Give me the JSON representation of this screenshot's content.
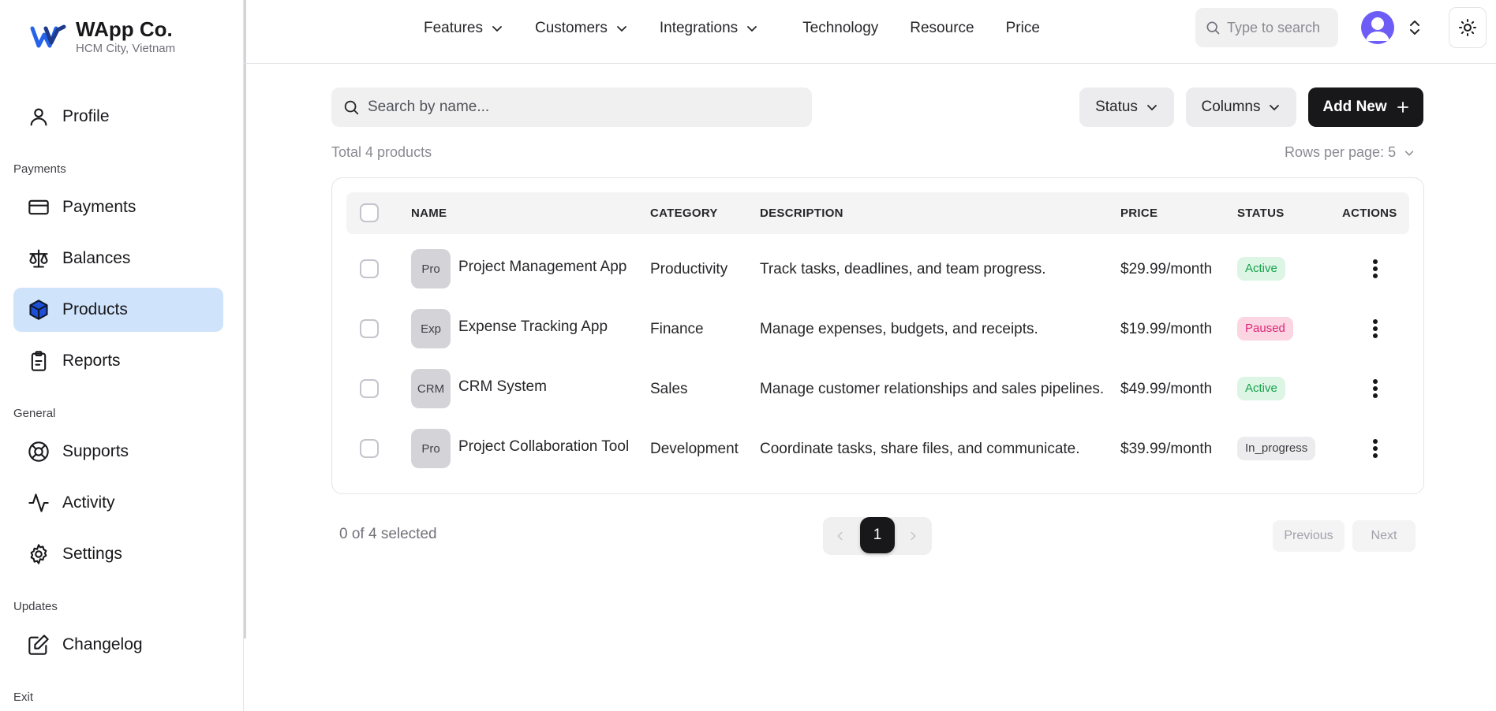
{
  "brand": {
    "name": "WApp Co.",
    "location": "HCM City, Vietnam"
  },
  "sidebar": {
    "profile": "Profile",
    "sections": {
      "payments": "Payments",
      "general": "General",
      "updates": "Updates",
      "exit": "Exit"
    },
    "items": {
      "payments": "Payments",
      "balances": "Balances",
      "products": "Products",
      "reports": "Reports",
      "supports": "Supports",
      "activity": "Activity",
      "settings": "Settings",
      "changelog": "Changelog"
    },
    "active": "products"
  },
  "topnav": {
    "links": [
      "Features",
      "Customers",
      "Integrations",
      "Technology",
      "Resource",
      "Price"
    ],
    "search_placeholder": "Type to search"
  },
  "toolbar": {
    "search_placeholder": "Search by name...",
    "status_label": "Status",
    "columns_label": "Columns",
    "add_label": "Add New"
  },
  "summary": {
    "total": "Total 4 products",
    "rows_per_page": "Rows per page: 5"
  },
  "table": {
    "headers": {
      "name": "NAME",
      "category": "CATEGORY",
      "description": "DESCRIPTION",
      "price": "PRICE",
      "status": "STATUS",
      "actions": "ACTIONS"
    },
    "rows": [
      {
        "thumb": "Pro",
        "name": "Project Management App",
        "category": "Productivity",
        "description": "Track tasks, deadlines, and team progress.",
        "price": "$29.99/month",
        "status": "Active",
        "status_type": "active"
      },
      {
        "thumb": "Exp",
        "name": "Expense Tracking App",
        "category": "Finance",
        "description": "Manage expenses, budgets, and receipts.",
        "price": "$19.99/month",
        "status": "Paused",
        "status_type": "paused"
      },
      {
        "thumb": "CRM",
        "name": "CRM System",
        "category": "Sales",
        "description": "Manage customer relationships and sales pipelines.",
        "price": "$49.99/month",
        "status": "Active",
        "status_type": "active"
      },
      {
        "thumb": "Pro",
        "name": "Project Collaboration Tool",
        "category": "Development",
        "description": "Coordinate tasks, share files, and communicate.",
        "price": "$39.99/month",
        "status": "In_progress",
        "status_type": "progress"
      }
    ]
  },
  "footer": {
    "selected": "0 of 4 selected",
    "current_page": "1",
    "previous": "Previous",
    "next": "Next"
  },
  "colors": {
    "accent": "#cfe3fb",
    "primary": "#18181b",
    "active": "#16a34a",
    "paused": "#db2777",
    "logo": "#1e40af"
  }
}
